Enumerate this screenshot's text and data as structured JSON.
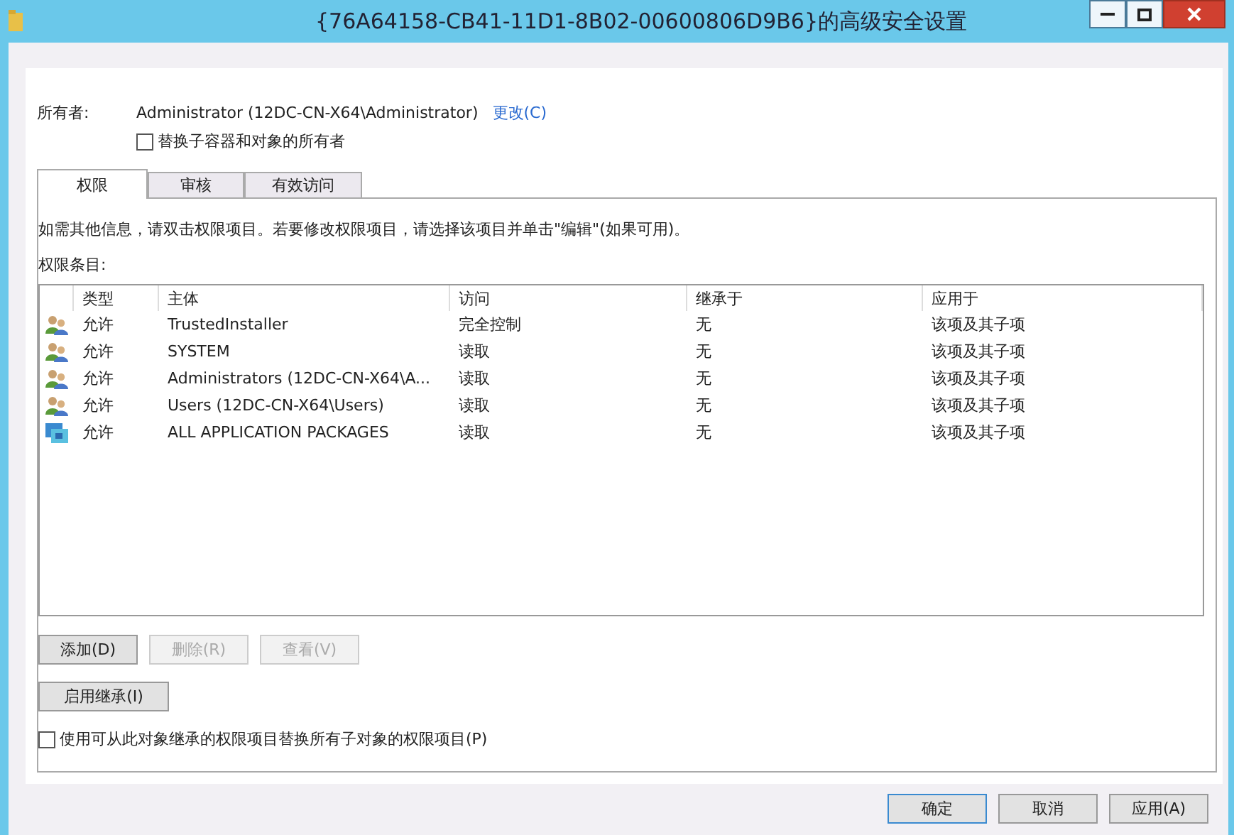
{
  "window": {
    "title": "{76A64158-CB41-11D1-8B02-00600806D9B6}的高级安全设置"
  },
  "owner": {
    "label": "所有者:",
    "value": "Administrator (12DC-CN-X64\\Administrator)",
    "change_link": "更改(C)"
  },
  "replace_owner": {
    "label": "替换子容器和对象的所有者",
    "checked": false
  },
  "tabs": [
    {
      "label": "权限",
      "selected": true
    },
    {
      "label": "审核",
      "selected": false
    },
    {
      "label": "有效访问",
      "selected": false
    }
  ],
  "info_text": "如需其他信息，请双击权限项目。若要修改权限项目，请选择该项目并单击\"编辑\"(如果可用)。",
  "entries_label": "权限条目:",
  "table": {
    "columns": [
      "类型",
      "主体",
      "访问",
      "继承于",
      "应用于"
    ],
    "rows": [
      {
        "kind": "group",
        "cells": [
          "允许",
          "TrustedInstaller",
          "完全控制",
          "无",
          "该项及其子项"
        ]
      },
      {
        "kind": "group",
        "cells": [
          "允许",
          "SYSTEM",
          "读取",
          "无",
          "该项及其子项"
        ]
      },
      {
        "kind": "group",
        "cells": [
          "允许",
          "Administrators (12DC-CN-X64\\A...",
          "读取",
          "无",
          "该项及其子项"
        ]
      },
      {
        "kind": "group",
        "cells": [
          "允许",
          "Users (12DC-CN-X64\\Users)",
          "读取",
          "无",
          "该项及其子项"
        ]
      },
      {
        "kind": "package",
        "cells": [
          "允许",
          "ALL APPLICATION PACKAGES",
          "读取",
          "无",
          "该项及其子项"
        ]
      }
    ]
  },
  "entry_buttons": [
    {
      "label": "添加(D)",
      "disabled": false
    },
    {
      "label": "删除(R)",
      "disabled": true
    },
    {
      "label": "查看(V)",
      "disabled": true
    }
  ],
  "inheritance_button": "启用继承(I)",
  "replace_children": {
    "label": "使用可从此对象继承的权限项目替换所有子对象的权限项目(P)",
    "checked": false
  },
  "footer_buttons": [
    {
      "label": "确定",
      "default": true
    },
    {
      "label": "取消",
      "default": false
    },
    {
      "label": "应用(A)",
      "default": false
    }
  ]
}
